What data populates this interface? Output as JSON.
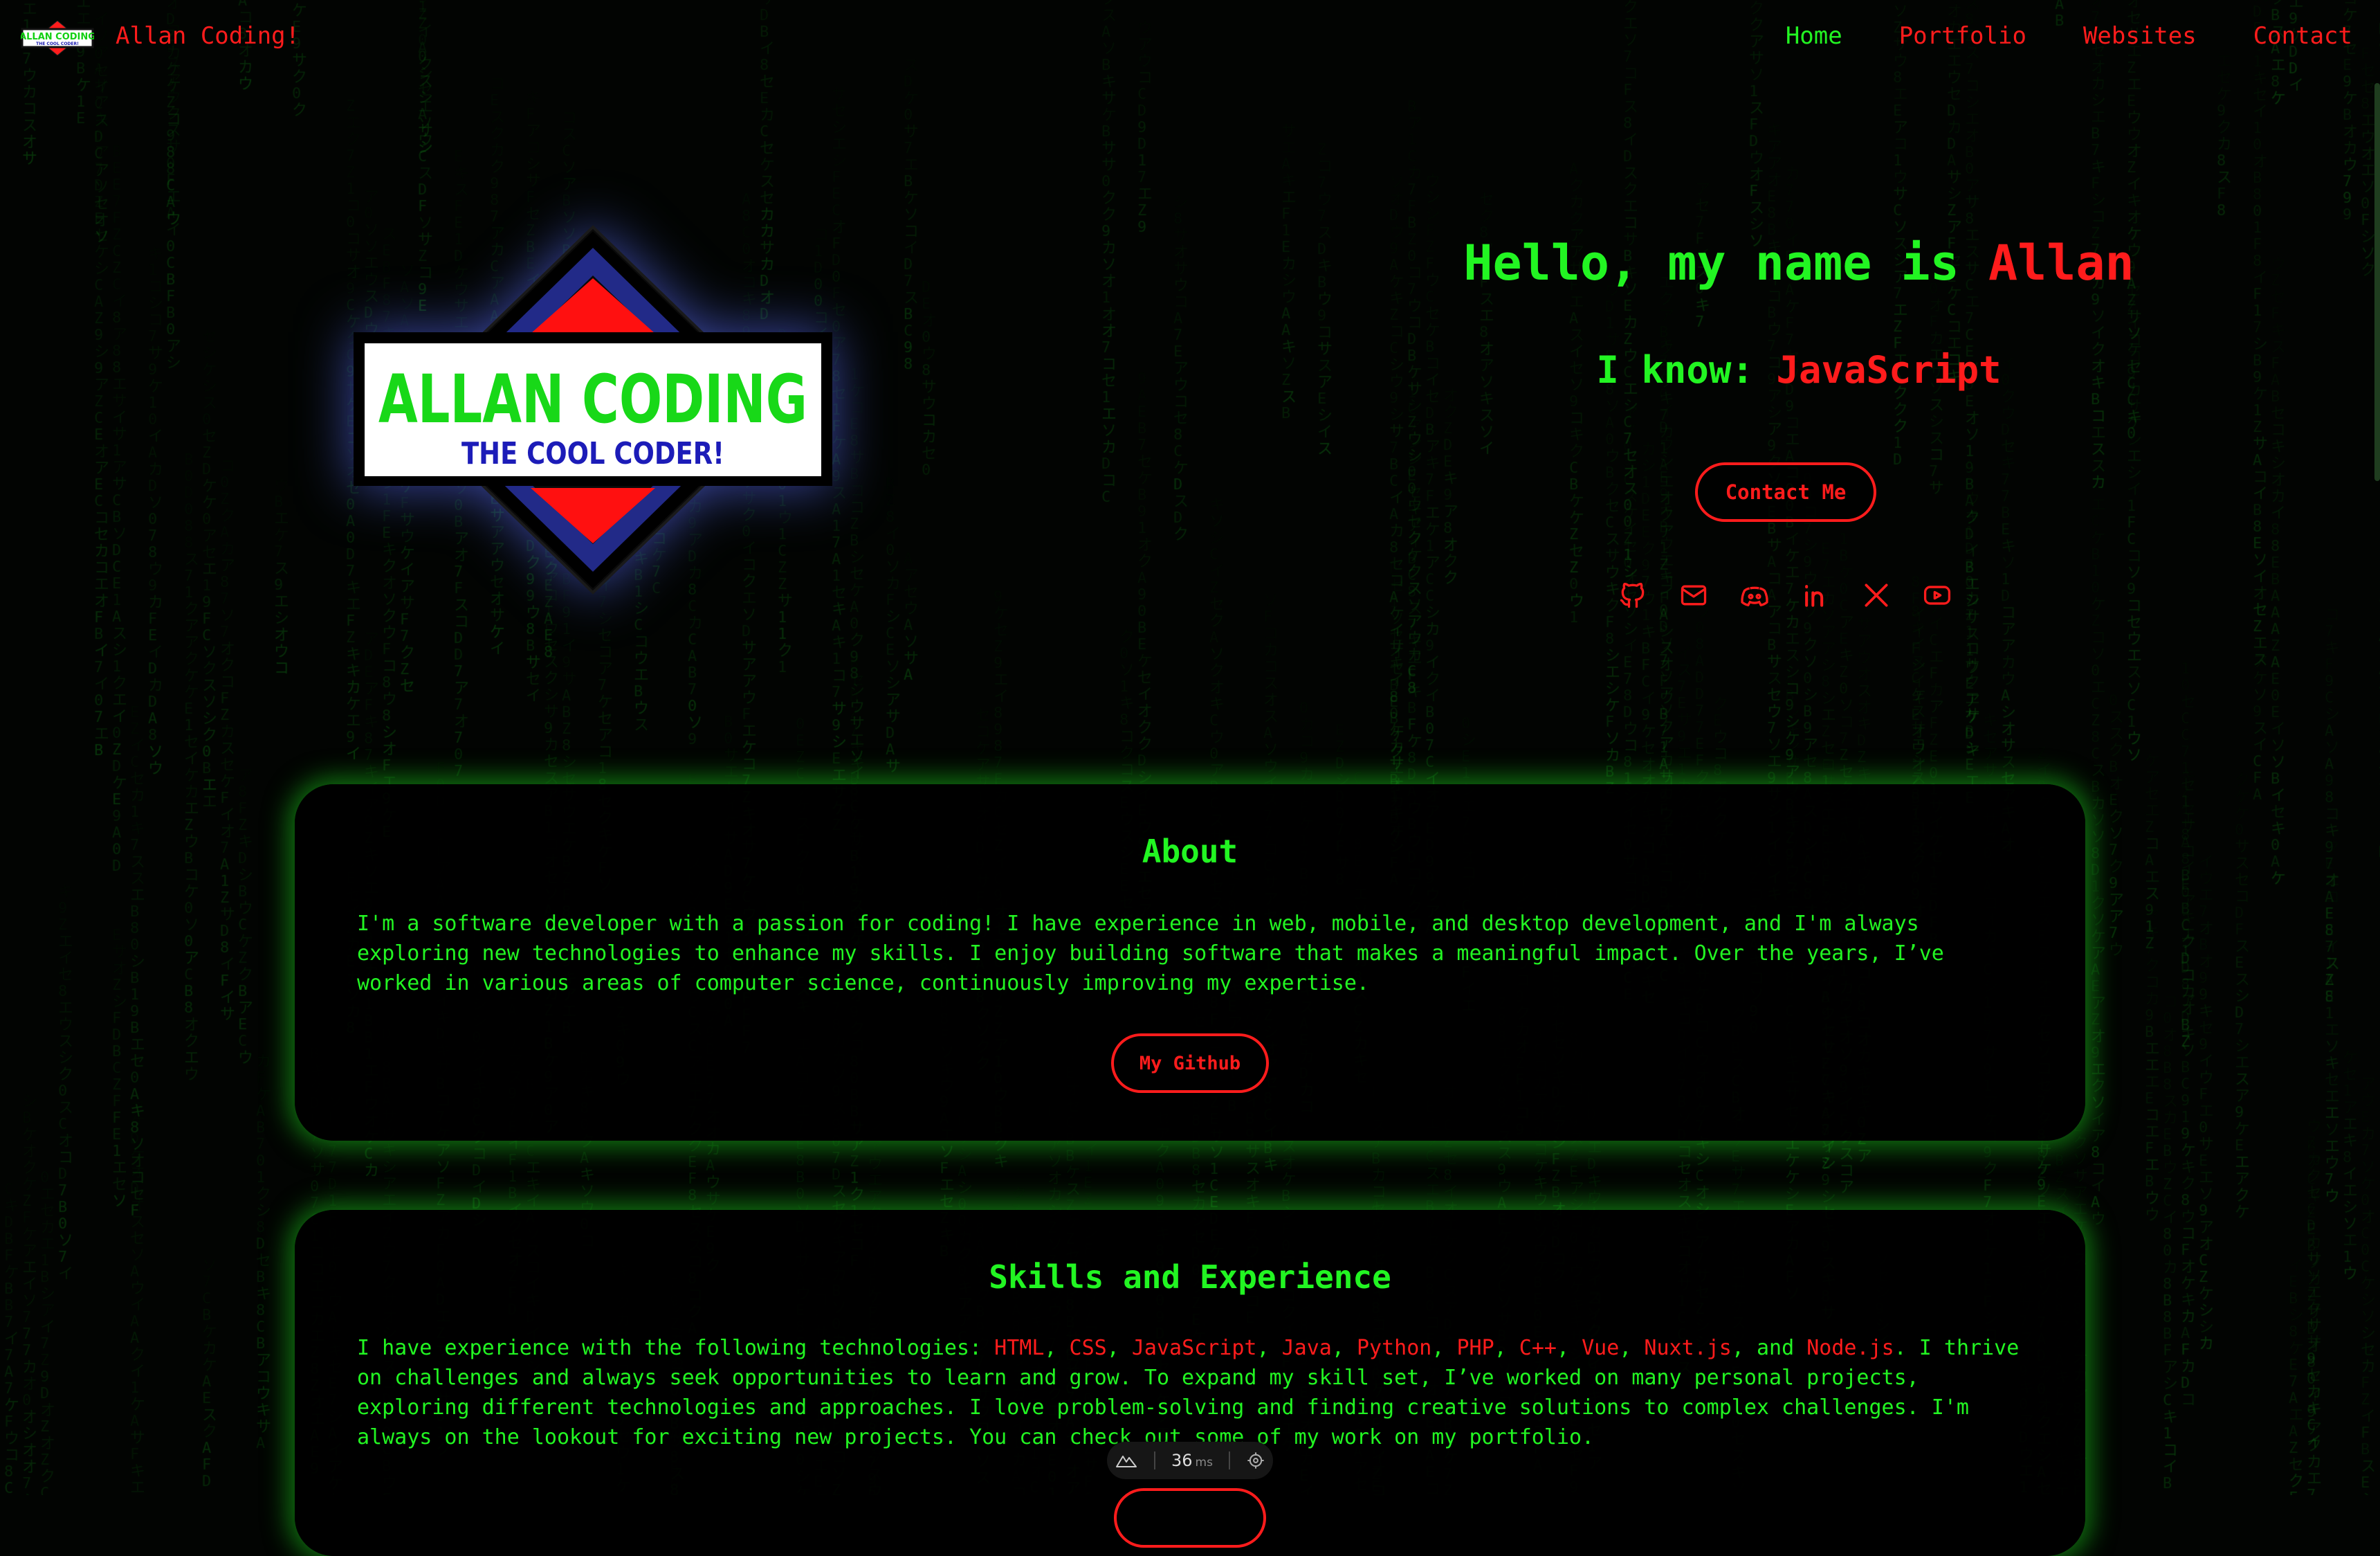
{
  "nav": {
    "title": "Allan Coding!",
    "links": [
      {
        "label": "Home",
        "active": true
      },
      {
        "label": "Portfolio",
        "active": false
      },
      {
        "label": "Websites",
        "active": false
      },
      {
        "label": "Contact",
        "active": false
      }
    ]
  },
  "logo": {
    "line1": "ALLAN CODING",
    "line2": "THE COOL CODER!"
  },
  "hero": {
    "hello_prefix": "Hello, my name is ",
    "name": "Allan",
    "know_prefix": "I know: ",
    "skill": "JavaScript",
    "contact_button": "Contact Me",
    "socials": [
      "github-icon",
      "mail-icon",
      "discord-icon",
      "linkedin-icon",
      "x-icon",
      "youtube-icon"
    ]
  },
  "about": {
    "title": "About",
    "text": "I'm a software developer with a passion for coding! I have experience in web, mobile, and desktop development, and I'm always exploring new technologies to enhance my skills. I enjoy building software that makes a meaningful impact. Over the years, I’ve worked in various areas of computer science, continuously improving my expertise.",
    "button": "My Github"
  },
  "skills": {
    "title": "Skills and Experience",
    "intro": "I have experience with the following technologies: ",
    "technologies": [
      "HTML",
      "CSS",
      "JavaScript",
      "Java",
      "Python",
      "PHP",
      "C++",
      "Vue",
      "Nuxt.js",
      "Node.js"
    ],
    "and_word": "and",
    "outro": ". I thrive on challenges and always seek opportunities to learn and grow. To expand my skill set, I’ve worked on many personal projects, exploring different technologies and approaches. I love problem-solving and finding creative solutions to complex challenges. I'm always on the lookout for exciting new projects. You can check out some of my work on my portfolio."
  },
  "devtools": {
    "ms_value": "36",
    "ms_unit": "ms"
  },
  "colors": {
    "green": "#22f522",
    "red": "#ff1c1c",
    "background": "#020402"
  }
}
